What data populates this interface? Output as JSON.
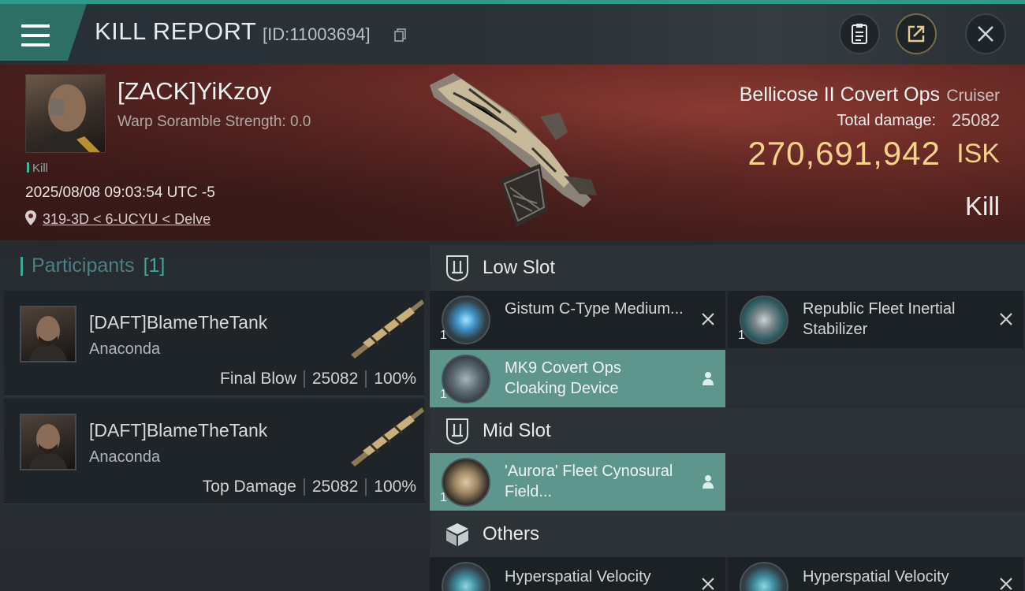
{
  "header": {
    "title": "KILL REPORT",
    "report_id": "[ID:11003694]"
  },
  "victim": {
    "name": "[ZACK]YiKzoy",
    "warp_scramble": "Warp Soramble Strength: 0.0",
    "tag": "Kill",
    "timestamp": "2025/08/08 09:03:54 UTC -5",
    "location": "319-3D < 6-UCYU < Delve"
  },
  "ship": {
    "name": "Bellicose II Covert Ops",
    "class": "Cruiser",
    "total_damage_label": "Total damage:",
    "total_damage": "25082",
    "isk_value": "270,691,942",
    "isk_unit": "ISK",
    "result": "Kill"
  },
  "participants": {
    "label": "Participants",
    "count": "[1]",
    "items": [
      {
        "name": "[DAFT]BlameTheTank",
        "ship": "Anaconda",
        "role": "Final Blow",
        "damage": "25082",
        "percent": "100%"
      },
      {
        "name": "[DAFT]BlameTheTank",
        "ship": "Anaconda",
        "role": "Top Damage",
        "damage": "25082",
        "percent": "100%"
      }
    ]
  },
  "slots": {
    "low": {
      "label": "Low Slot",
      "items": [
        {
          "name": "Gistum C-Type Medium...",
          "qty": "1",
          "status": "destroyed"
        },
        {
          "name": "Republic Fleet Inertial Stabilizer",
          "qty": "1",
          "status": "destroyed"
        },
        {
          "name": "MK9 Covert Ops Cloaking Device",
          "qty": "1",
          "status": "dropped"
        }
      ]
    },
    "mid": {
      "label": "Mid Slot",
      "items": [
        {
          "name": "'Aurora' Fleet Cynosural Field...",
          "qty": "1",
          "status": "dropped"
        }
      ]
    },
    "others": {
      "label": "Others",
      "items": [
        {
          "name": "Hyperspatial Velocity",
          "qty": "1",
          "status": "destroyed"
        },
        {
          "name": "Hyperspatial Velocity",
          "qty": "1",
          "status": "destroyed"
        }
      ]
    }
  },
  "colors": {
    "accent": "#2f9a8a",
    "fitted_bg": "#5e968d",
    "isk": "#f6d28a"
  },
  "icons": {
    "menu": "hamburger-menu-icon",
    "copy": "copy-icon",
    "clipboard": "clipboard-icon",
    "share": "share-icon",
    "close": "close-icon",
    "location": "location-pin-icon"
  }
}
